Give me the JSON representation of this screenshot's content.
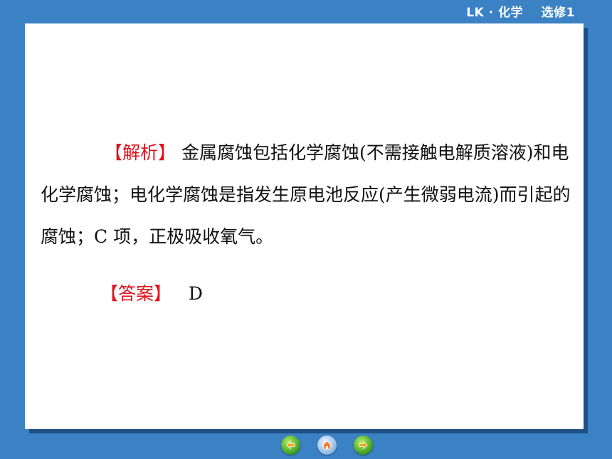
{
  "header": {
    "label": "LK · 化学    选修1"
  },
  "content": {
    "analysis_tag": "【解析】",
    "analysis_text": "  金属腐蚀包括化学腐蚀(不需接触电解质溶液)和电化学腐蚀；电化学腐蚀是指发生原电池反应(产生微弱电流)而引起的腐蚀；C 项，正极吸收氧气。",
    "answer_tag": "【答案】",
    "answer_text": "   D"
  },
  "nav": {
    "prev_icon": "arrow-left-icon",
    "home_icon": "home-icon",
    "next_icon": "arrow-right-icon"
  },
  "colors": {
    "background": "#3b82c4",
    "tag_red": "#e0141e",
    "slide": "#ffffff"
  }
}
